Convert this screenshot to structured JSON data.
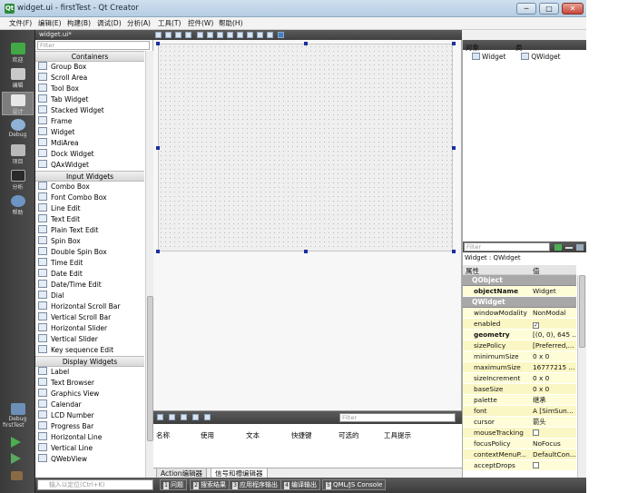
{
  "window": {
    "title": "widget.ui - firstTest - Qt Creator",
    "app_icon": "Qt",
    "min": "─",
    "max": "□",
    "close": "✕"
  },
  "menu": [
    "文件(F)",
    "编辑(E)",
    "构建(B)",
    "调试(D)",
    "分析(A)",
    "工具(T)",
    "控件(W)",
    "帮助(H)"
  ],
  "modes": [
    "欢迎",
    "编辑",
    "设计",
    "Debug",
    "项目",
    "分析",
    "帮助"
  ],
  "project": {
    "label": "firstTest",
    "mode": "Debug"
  },
  "sidebar": {
    "title": "widget.ui*",
    "filter": "Filter",
    "categories": [
      {
        "name": "Containers",
        "items": [
          "Group Box",
          "Scroll Area",
          "Tool Box",
          "Tab Widget",
          "Stacked Widget",
          "Frame",
          "Widget",
          "MdiArea",
          "Dock Widget",
          "QAxWidget"
        ]
      },
      {
        "name": "Input Widgets",
        "items": [
          "Combo Box",
          "Font Combo Box",
          "Line Edit",
          "Text Edit",
          "Plain Text Edit",
          "Spin Box",
          "Double Spin Box",
          "Time Edit",
          "Date Edit",
          "Date/Time Edit",
          "Dial",
          "Horizontal Scroll Bar",
          "Vertical Scroll Bar",
          "Horizontal Slider",
          "Vertical Slider",
          "Key sequence Edit"
        ]
      },
      {
        "name": "Display Widgets",
        "items": [
          "Label",
          "Text Browser",
          "Graphics View",
          "Calendar",
          "LCD Number",
          "Progress Bar",
          "Horizontal Line",
          "Vertical Line",
          "QWebView"
        ]
      }
    ]
  },
  "actions": {
    "filter": "Filter",
    "headers": [
      "名称",
      "使用",
      "文本",
      "快捷键",
      "可选的",
      "工具提示"
    ],
    "tabs": [
      "Action编辑器",
      "信号和槽编辑器"
    ]
  },
  "objects": {
    "headers": [
      "对象",
      "类"
    ],
    "row": {
      "name": "Widget",
      "class": "QWidget"
    }
  },
  "properties": {
    "filter": "Filter",
    "class_label": "Widget : QWidget",
    "headers": [
      "属性",
      "值"
    ],
    "groups": [
      {
        "name": "QObject",
        "rows": [
          {
            "name": "objectName",
            "value": "Widget",
            "bold": true
          }
        ]
      },
      {
        "name": "QWidget",
        "rows": [
          {
            "name": "windowModality",
            "value": "NonModal"
          },
          {
            "name": "enabled",
            "value": "✓",
            "check": true
          },
          {
            "name": "geometry",
            "value": "[(0, 0), 645 ...",
            "bold": true
          },
          {
            "name": "sizePolicy",
            "value": "[Preferred,..."
          },
          {
            "name": "minimumSize",
            "value": "0 x 0"
          },
          {
            "name": "maximumSize",
            "value": "16777215 ..."
          },
          {
            "name": "sizeIncrement",
            "value": "0 x 0"
          },
          {
            "name": "baseSize",
            "value": "0 x 0"
          },
          {
            "name": "palette",
            "value": "继承"
          },
          {
            "name": "font",
            "value": "A [SimSun..."
          },
          {
            "name": "cursor",
            "value": "箭头"
          },
          {
            "name": "mouseTracking",
            "value": "",
            "check": true
          },
          {
            "name": "focusPolicy",
            "value": "NoFocus"
          },
          {
            "name": "contextMenuP...",
            "value": "DefaultCon..."
          },
          {
            "name": "acceptDrops",
            "value": "",
            "check": true
          }
        ]
      }
    ]
  },
  "status": {
    "locator": "输入以定位(Ctrl+K)",
    "buttons": [
      {
        "num": "1",
        "label": "问题"
      },
      {
        "num": "2",
        "label": "搜索结果"
      },
      {
        "num": "3",
        "label": "应用程序输出"
      },
      {
        "num": "4",
        "label": "编译输出"
      },
      {
        "num": "5",
        "label": "QML/JS Console"
      }
    ]
  }
}
